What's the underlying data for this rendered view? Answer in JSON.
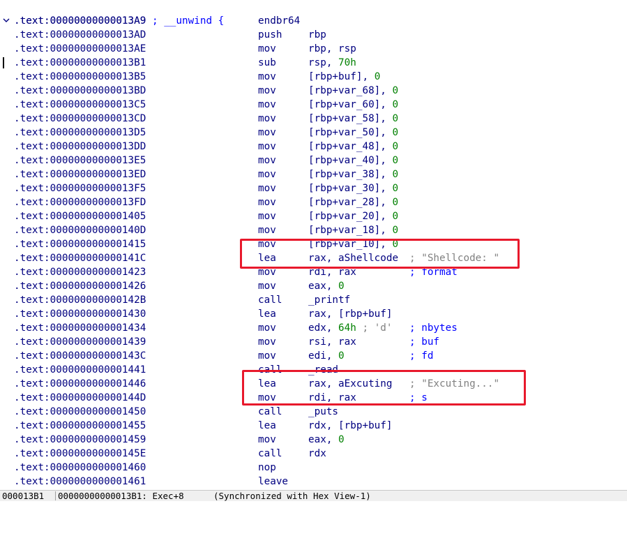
{
  "header_line": {
    "addr": ".text:00000000000013A9",
    "comment": "; __unwind {"
  },
  "rows": [
    {
      "addr": ".text:00000000000013A9",
      "mn": "endbr64",
      "op": []
    },
    {
      "addr": ".text:00000000000013AD",
      "mn": "push",
      "op": [
        {
          "t": "rbp"
        }
      ]
    },
    {
      "addr": ".text:00000000000013AE",
      "mn": "mov",
      "op": [
        {
          "t": "rbp, rsp"
        }
      ]
    },
    {
      "addr": ".text:00000000000013B1",
      "mn": "sub",
      "op": [
        {
          "t": "rsp, "
        },
        {
          "t": "70h",
          "c": "num"
        }
      ],
      "cursor": true
    },
    {
      "addr": ".text:00000000000013B5",
      "mn": "mov",
      "op": [
        {
          "t": "[rbp+buf], "
        },
        {
          "t": "0",
          "c": "num"
        }
      ]
    },
    {
      "addr": ".text:00000000000013BD",
      "mn": "mov",
      "op": [
        {
          "t": "[rbp+var_68], "
        },
        {
          "t": "0",
          "c": "num"
        }
      ]
    },
    {
      "addr": ".text:00000000000013C5",
      "mn": "mov",
      "op": [
        {
          "t": "[rbp+var_60], "
        },
        {
          "t": "0",
          "c": "num"
        }
      ]
    },
    {
      "addr": ".text:00000000000013CD",
      "mn": "mov",
      "op": [
        {
          "t": "[rbp+var_58], "
        },
        {
          "t": "0",
          "c": "num"
        }
      ]
    },
    {
      "addr": ".text:00000000000013D5",
      "mn": "mov",
      "op": [
        {
          "t": "[rbp+var_50], "
        },
        {
          "t": "0",
          "c": "num"
        }
      ]
    },
    {
      "addr": ".text:00000000000013DD",
      "mn": "mov",
      "op": [
        {
          "t": "[rbp+var_48], "
        },
        {
          "t": "0",
          "c": "num"
        }
      ]
    },
    {
      "addr": ".text:00000000000013E5",
      "mn": "mov",
      "op": [
        {
          "t": "[rbp+var_40], "
        },
        {
          "t": "0",
          "c": "num"
        }
      ]
    },
    {
      "addr": ".text:00000000000013ED",
      "mn": "mov",
      "op": [
        {
          "t": "[rbp+var_38], "
        },
        {
          "t": "0",
          "c": "num"
        }
      ]
    },
    {
      "addr": ".text:00000000000013F5",
      "mn": "mov",
      "op": [
        {
          "t": "[rbp+var_30], "
        },
        {
          "t": "0",
          "c": "num"
        }
      ]
    },
    {
      "addr": ".text:00000000000013FD",
      "mn": "mov",
      "op": [
        {
          "t": "[rbp+var_28], "
        },
        {
          "t": "0",
          "c": "num"
        }
      ]
    },
    {
      "addr": ".text:0000000000001405",
      "mn": "mov",
      "op": [
        {
          "t": "[rbp+var_20], "
        },
        {
          "t": "0",
          "c": "num"
        }
      ]
    },
    {
      "addr": ".text:000000000000140D",
      "mn": "mov",
      "op": [
        {
          "t": "[rbp+var_18], "
        },
        {
          "t": "0",
          "c": "num"
        }
      ]
    },
    {
      "addr": ".text:0000000000001415",
      "mn": "mov",
      "op": [
        {
          "t": "[rbp+var_10], "
        },
        {
          "t": "0",
          "c": "num"
        }
      ]
    },
    {
      "addr": ".text:000000000000141C",
      "mn": "lea",
      "op": [
        {
          "t": "rax, aShellcode"
        }
      ],
      "cm": [
        {
          "t": "; ",
          "c": "str-c"
        },
        {
          "t": "\"Shellcode: \"",
          "c": "str-c"
        }
      ]
    },
    {
      "addr": ".text:0000000000001423",
      "mn": "mov",
      "op": [
        {
          "t": "rdi, rax"
        }
      ],
      "cm": [
        {
          "t": "; format"
        }
      ]
    },
    {
      "addr": ".text:0000000000001426",
      "mn": "mov",
      "op": [
        {
          "t": "eax, "
        },
        {
          "t": "0",
          "c": "num"
        }
      ]
    },
    {
      "addr": ".text:000000000000142B",
      "mn": "call",
      "op": [
        {
          "t": "_printf"
        }
      ]
    },
    {
      "addr": ".text:0000000000001430",
      "mn": "lea",
      "op": [
        {
          "t": "rax, [rbp+buf]"
        }
      ]
    },
    {
      "addr": ".text:0000000000001434",
      "mn": "mov",
      "op": [
        {
          "t": "edx, "
        },
        {
          "t": "64h",
          "c": "num"
        },
        {
          "t": " ; ",
          "c": "str-c"
        },
        {
          "t": "'d'",
          "c": "str-c"
        }
      ],
      "cm": [
        {
          "t": "; nbytes"
        }
      ]
    },
    {
      "addr": ".text:0000000000001439",
      "mn": "mov",
      "op": [
        {
          "t": "rsi, rax"
        }
      ],
      "cm": [
        {
          "t": "; buf"
        }
      ]
    },
    {
      "addr": ".text:000000000000143C",
      "mn": "mov",
      "op": [
        {
          "t": "edi, "
        },
        {
          "t": "0",
          "c": "num"
        }
      ],
      "cm": [
        {
          "t": "; fd"
        }
      ]
    },
    {
      "addr": ".text:0000000000001441",
      "mn": "call",
      "op": [
        {
          "t": "_read"
        }
      ]
    },
    {
      "addr": ".text:0000000000001446",
      "mn": "lea",
      "op": [
        {
          "t": "rax, aExcuting"
        }
      ],
      "cm": [
        {
          "t": "; ",
          "c": "str-c"
        },
        {
          "t": "\"Excuting...\"",
          "c": "str-c"
        }
      ]
    },
    {
      "addr": ".text:000000000000144D",
      "mn": "mov",
      "op": [
        {
          "t": "rdi, rax"
        }
      ],
      "cm": [
        {
          "t": "; s"
        }
      ]
    },
    {
      "addr": ".text:0000000000001450",
      "mn": "call",
      "op": [
        {
          "t": "_puts"
        }
      ]
    },
    {
      "addr": ".text:0000000000001455",
      "mn": "lea",
      "op": [
        {
          "t": "rdx, [rbp+buf]"
        }
      ]
    },
    {
      "addr": ".text:0000000000001459",
      "mn": "mov",
      "op": [
        {
          "t": "eax, "
        },
        {
          "t": "0",
          "c": "num"
        }
      ]
    },
    {
      "addr": ".text:000000000000145E",
      "mn": "call",
      "op": [
        {
          "t": "rdx"
        }
      ]
    },
    {
      "addr": ".text:0000000000001460",
      "mn": "nop",
      "op": []
    },
    {
      "addr": ".text:0000000000001461",
      "mn": "leave",
      "op": []
    }
  ],
  "status_bar": {
    "offset": "000013B1",
    "location": "00000000000013B1: Exec+8",
    "sync": "(Synchronized with Hex View-1)"
  },
  "colors": {
    "highlight_box": "#e8192c",
    "address": "#000080",
    "number": "#008000",
    "comment": "#0000ff",
    "string_comment": "#808080"
  }
}
